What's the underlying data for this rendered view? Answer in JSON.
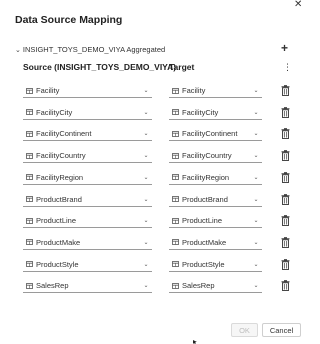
{
  "dialog": {
    "title": "Data Source Mapping",
    "close_icon": "close-icon",
    "group_label": "INSIGHT_TOYS_DEMO_VIYA Aggregated",
    "add_icon": "plus-icon",
    "menu_icon": "kebab-icon",
    "source_header": "Source (INSIGHT_TOYS_DEMO_VIYA)",
    "target_header": "Target",
    "rows": [
      {
        "source": "Facility",
        "target": "Facility"
      },
      {
        "source": "FacilityCity",
        "target": "FacilityCity"
      },
      {
        "source": "FacilityContinent",
        "target": "FacilityContinent"
      },
      {
        "source": "FacilityCountry",
        "target": "FacilityCountry"
      },
      {
        "source": "FacilityRegion",
        "target": "FacilityRegion"
      },
      {
        "source": "ProductBrand",
        "target": "ProductBrand"
      },
      {
        "source": "ProductLine",
        "target": "ProductLine"
      },
      {
        "source": "ProductMake",
        "target": "ProductMake"
      },
      {
        "source": "ProductStyle",
        "target": "ProductStyle"
      },
      {
        "source": "SalesRep",
        "target": "SalesRep"
      }
    ],
    "ok_label": "OK",
    "cancel_label": "Cancel"
  },
  "colors": {
    "text": "#1f1f1f",
    "border": "#9a9a9a",
    "disabled_text": "#bdbdbd"
  }
}
